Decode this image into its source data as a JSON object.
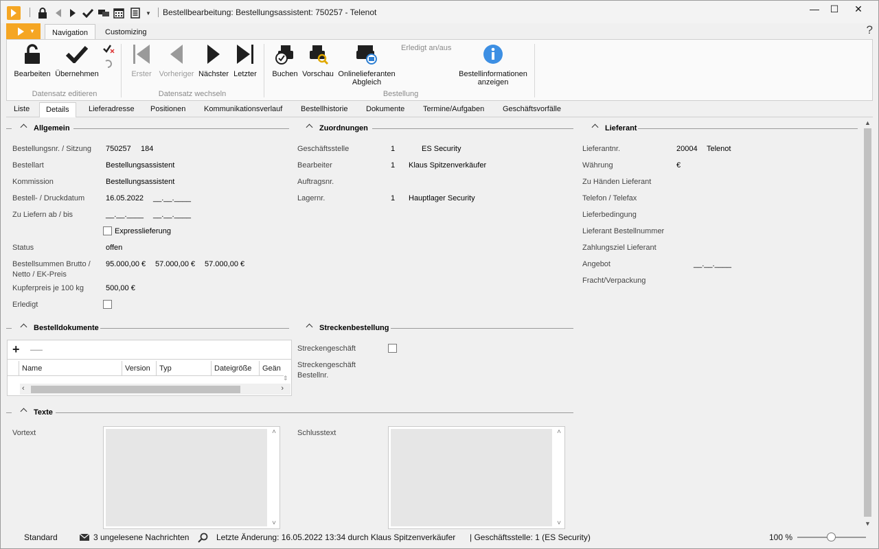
{
  "window": {
    "title": "Bestellbearbeitung: Bestellungsassistent: 750257 - Telenot",
    "minimize": "—",
    "maximize": "☐",
    "close": "✕"
  },
  "quick_access": {
    "icons": [
      "lock-icon",
      "back-icon",
      "forward-icon",
      "check-icon",
      "chat-icon",
      "calendar-icon",
      "list-icon",
      "dropdown-icon"
    ]
  },
  "ribbon_tabs": {
    "navigation": "Navigation",
    "customizing": "Customizing",
    "help": "?"
  },
  "ribbon": {
    "bearbeiten": "Bearbeiten",
    "uebernehmen": "Übernehmen",
    "erster": "Erster",
    "vorheriger": "Vorheriger",
    "naechster": "Nächster",
    "letzter": "Letzter",
    "buchen": "Buchen",
    "vorschau": "Vorschau",
    "onlinelieferanten": "Onlinelieferanten",
    "abgleich": "Abgleich",
    "erledigt_anaus": "Erledigt an/aus",
    "bestellinfo_1": "Bestellinformationen",
    "bestellinfo_2": "anzeigen",
    "group_datensatz_editieren": "Datensatz editieren",
    "group_datensatz_wechseln": "Datensatz wechseln",
    "group_bestellung": "Bestellung"
  },
  "content_tabs": [
    "Liste",
    "Details",
    "Lieferadresse",
    "Positionen",
    "Kommunikationsverlauf",
    "Bestellhistorie",
    "Dokumente",
    "Termine/Aufgaben",
    "Geschäftsvorfälle"
  ],
  "allgemein": {
    "title": "Allgemein",
    "bestellnr_label": "Bestellungsnr. / Sitzung",
    "bestellnr": "750257",
    "sitzung": "184",
    "bestellart_label": "Bestellart",
    "bestellart": "Bestellungsassistent",
    "kommission_label": "Kommission",
    "kommission": "Bestellungsassistent",
    "datum_label": "Bestell- / Druckdatum",
    "bestelldatum": "16.05.2022",
    "druckdatum": "__.__.____",
    "liefern_label": "Zu Liefern ab / bis",
    "liefern_ab": "__.__.____",
    "liefern_bis": "__.__.____",
    "express_label": "Expresslieferung",
    "status_label": "Status",
    "status": "offen",
    "summen_label_1": "Bestellsummen Brutto /",
    "summen_label_2": "Netto / EK-Preis",
    "brutto": "95.000,00 €",
    "netto": "57.000,00 €",
    "ek": "57.000,00 €",
    "kupfer_label": "Kupferpreis je 100 kg",
    "kupfer": "500,00 €",
    "erledigt_label": "Erledigt"
  },
  "zuordnungen": {
    "title": "Zuordnungen",
    "geschaeftsstelle_label": "Geschäftsstelle",
    "geschaeftsstelle_nr": "1",
    "geschaeftsstelle": "ES Security",
    "bearbeiter_label": "Bearbeiter",
    "bearbeiter_nr": "1",
    "bearbeiter": "Klaus Spitzenverkäufer",
    "auftragsnr_label": "Auftragsnr.",
    "lagernr_label": "Lagernr.",
    "lager_nr": "1",
    "lager": "Hauptlager Security"
  },
  "lieferant": {
    "title": "Lieferant",
    "lieferantnr_label": "Lieferantnr.",
    "lieferantnr": "20004",
    "lieferant": "Telenot",
    "waehrung_label": "Währung",
    "waehrung": "€",
    "zu_haenden_label": "Zu Händen Lieferant",
    "telefon_label": "Telefon / Telefax",
    "lieferbedingung_label": "Lieferbedingung",
    "bestellnummer_label": "Lieferant Bestellnummer",
    "zahlungsziel_label": "Zahlungsziel Lieferant",
    "angebot_label": "Angebot",
    "angebot_datum": "__.__.____",
    "fracht_label": "Fracht/Verpackung"
  },
  "bestelldokumente": {
    "title": "Bestelldokumente",
    "add": "+",
    "remove": "—",
    "columns": [
      "Name",
      "Version",
      "Typ",
      "Dateigröße",
      "Geän"
    ]
  },
  "streckenbestellung": {
    "title": "Streckenbestellung",
    "streckengeschaeft_label": "Streckengeschäft",
    "strecken_bestellnr_1": "Streckengeschäft",
    "strecken_bestellnr_2": "Bestellnr."
  },
  "texte": {
    "title": "Texte",
    "vortext_label": "Vortext",
    "schlusstext_label": "Schlusstext"
  },
  "statusbar": {
    "layout": "Standard",
    "nachrichten": "3 ungelesene Nachrichten",
    "letzte_aenderung": "Letzte Änderung: 16.05.2022 13:34 durch Klaus Spitzenverkäufer",
    "geschaeftsstelle": "| Geschäftsstelle:  1 (ES Security)",
    "zoom": "100 %"
  }
}
